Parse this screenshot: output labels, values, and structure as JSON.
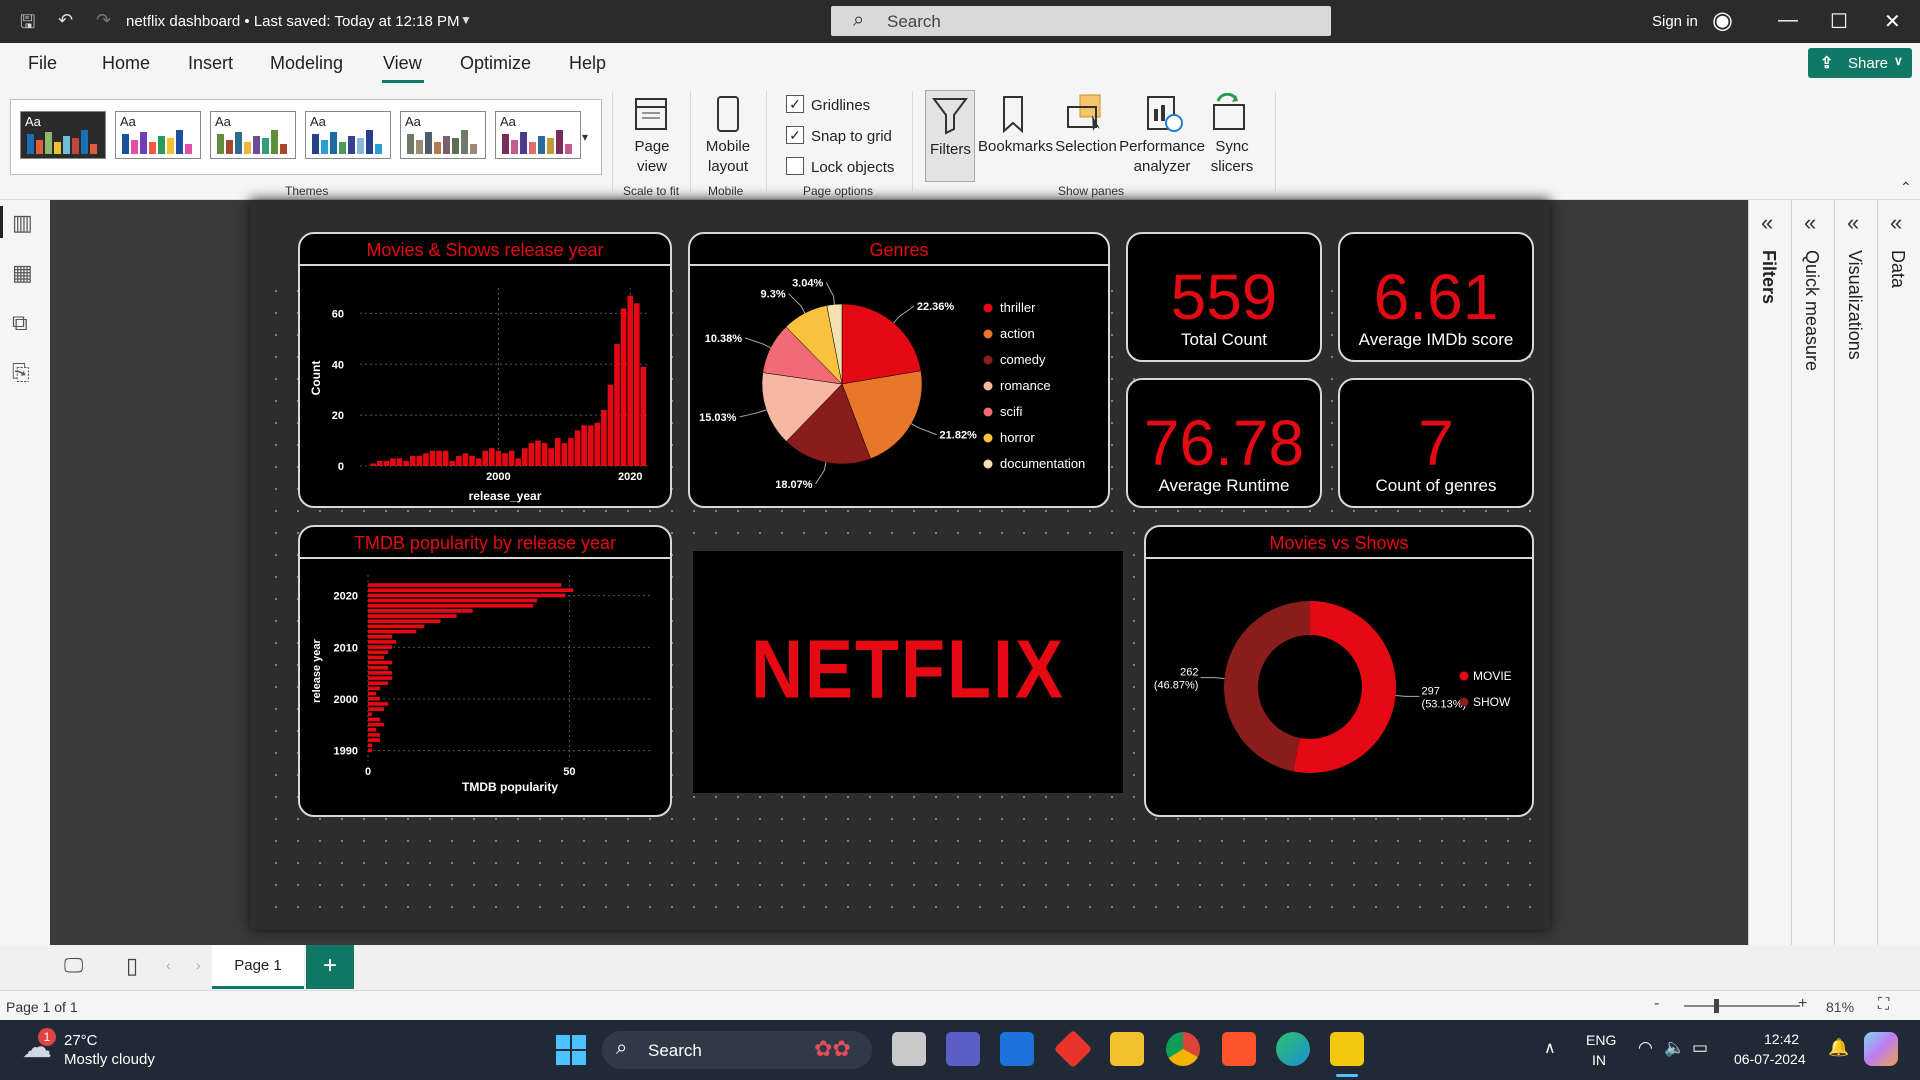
{
  "titlebar": {
    "doc_title": "netflix dashboard • Last saved: Today at 12:18 PM",
    "search_placeholder": "Search",
    "sign_in": "Sign in"
  },
  "menu": {
    "items": [
      "File",
      "Home",
      "Insert",
      "Modeling",
      "View",
      "Optimize",
      "Help"
    ],
    "share": "Share"
  },
  "ribbon": {
    "themes_label": "Themes",
    "theme_aa": "Aa",
    "page_view": "Page view",
    "scale_to_fit": "Scale to fit",
    "mobile_layout": "Mobile layout",
    "mobile": "Mobile",
    "gridlines": "Gridlines",
    "snap_to_grid": "Snap to grid",
    "lock_objects": "Lock objects",
    "page_options": "Page options",
    "filters": "Filters",
    "bookmarks": "Bookmarks",
    "selection": "Selection",
    "performance_analyzer": "Performance analyzer",
    "sync_slicers": "Sync slicers",
    "show_panes": "Show panes"
  },
  "panes": [
    "Filters",
    "Quick measure",
    "Visualizations",
    "Data"
  ],
  "kpis": [
    {
      "value": "559",
      "label": "Total Count"
    },
    {
      "value": "6.61",
      "label": "Average IMDb score"
    },
    {
      "value": "76.78",
      "label": "Average Runtime"
    },
    {
      "value": "7",
      "label": "Count of genres"
    }
  ],
  "netflix_logo": "NETFLIX",
  "colors": {
    "accent": "#e50914",
    "green": "#117865"
  },
  "chart_data": [
    {
      "type": "bar",
      "title": "Movies & Shows release year",
      "xlabel": "release_year",
      "ylabel": "Count",
      "x_ticks": [
        "2000",
        "2020"
      ],
      "y_ticks": [
        "0",
        "20",
        "40",
        "60"
      ],
      "ylim": [
        0,
        70
      ],
      "xlim": [
        1979,
        2023
      ],
      "x": [
        1981,
        1982,
        1983,
        1984,
        1985,
        1986,
        1987,
        1988,
        1989,
        1990,
        1991,
        1992,
        1993,
        1994,
        1995,
        1996,
        1997,
        1998,
        1999,
        2000,
        2001,
        2002,
        2003,
        2004,
        2005,
        2006,
        2007,
        2008,
        2009,
        2010,
        2011,
        2012,
        2013,
        2014,
        2015,
        2016,
        2017,
        2018,
        2019,
        2020,
        2021,
        2022
      ],
      "values": [
        1,
        2,
        2,
        3,
        3,
        2,
        4,
        4,
        5,
        6,
        6,
        6,
        2,
        4,
        5,
        4,
        3,
        6,
        7,
        6,
        5,
        6,
        3,
        7,
        9,
        10,
        9,
        7,
        11,
        9,
        11,
        14,
        16,
        16,
        17,
        22,
        32,
        48,
        62,
        67,
        64,
        39
      ],
      "gridlines": true
    },
    {
      "type": "pie",
      "title": "Genres",
      "labels": [
        "thriller",
        "action",
        "comedy",
        "romance",
        "scifi",
        "horror",
        "documentation"
      ],
      "values": [
        22.36,
        21.82,
        18.07,
        15.03,
        10.38,
        9.3,
        3.04
      ],
      "value_labels": [
        "22.36%",
        "21.82%",
        "18.07%",
        "15.03%",
        "10.38%",
        "9.3%",
        "3.04%"
      ],
      "colors": [
        "#e50914",
        "#e8762b",
        "#8a1c1c",
        "#f7b7a3",
        "#f06b73",
        "#f8c23c",
        "#f4e0b0"
      ],
      "legend": "right"
    },
    {
      "type": "bar",
      "orientation": "horizontal",
      "title": "TMDB popularity by release year",
      "xlabel": "TMDB popularity",
      "ylabel": "release year",
      "x_ticks": [
        "0",
        "50"
      ],
      "y_ticks": [
        "2020",
        "2010",
        "2000",
        "1990"
      ],
      "xlim": [
        0,
        70
      ],
      "ylim": [
        1988,
        2024
      ],
      "years": [
        1990,
        1991,
        1992,
        1993,
        1994,
        1995,
        1996,
        1997,
        1998,
        1999,
        2000,
        2001,
        2002,
        2003,
        2004,
        2005,
        2006,
        2007,
        2008,
        2009,
        2010,
        2011,
        2012,
        2013,
        2014,
        2015,
        2016,
        2017,
        2018,
        2019,
        2020,
        2021,
        2022
      ],
      "values": [
        1,
        1,
        3,
        3,
        2,
        4,
        3,
        1,
        4,
        5,
        3,
        2,
        3,
        5,
        6,
        6,
        5,
        6,
        4,
        5,
        6,
        7,
        6,
        12,
        14,
        18,
        22,
        26,
        41,
        42,
        49,
        51,
        48
      ],
      "gridlines": true
    },
    {
      "type": "pie",
      "donut": true,
      "title": "Movies vs Shows",
      "labels": [
        "MOVIE",
        "SHOW"
      ],
      "values": [
        297,
        262
      ],
      "percents": [
        "53.13%",
        "46.87%"
      ],
      "value_labels": [
        "297",
        "262"
      ],
      "colors": [
        "#e50914",
        "#8a1c1c"
      ],
      "legend": "right"
    }
  ],
  "tabs": {
    "page": "Page 1",
    "add": "+",
    "status": "Page 1 of 1",
    "zoom": "81%"
  },
  "taskbar": {
    "temp": "27°C",
    "weather": "Mostly cloudy",
    "badge": "1",
    "search": "Search",
    "lang1": "ENG",
    "lang2": "IN",
    "time": "12:42",
    "date": "06-07-2024"
  }
}
